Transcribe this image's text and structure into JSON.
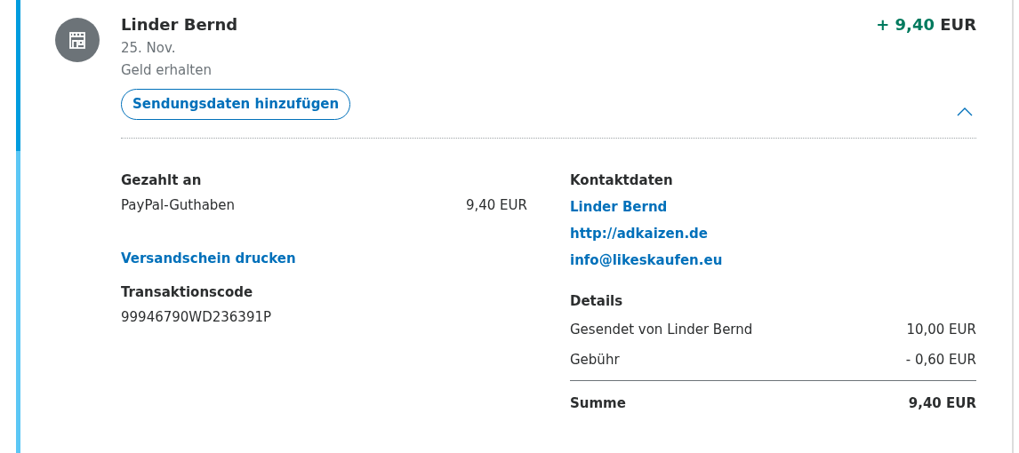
{
  "transaction": {
    "name": "Linder Bernd",
    "date": "25. Nov.",
    "status": "Geld erhalten",
    "amount": "+ 9,40",
    "currency": "EUR",
    "action_button": "Sendungsdaten hinzufügen",
    "expanded": true
  },
  "paid_to": {
    "title": "Gezahlt an",
    "rows": [
      {
        "label": "PayPal-Guthaben",
        "value": "9,40 EUR"
      }
    ]
  },
  "print_link": "Versandschein drucken",
  "transaction_code": {
    "title": "Transaktionscode",
    "value": "99946790WD236391P"
  },
  "contact": {
    "title": "Kontaktdaten",
    "links": [
      "Linder Bernd",
      "http://adkaizen.de",
      "info@likeskaufen.eu"
    ]
  },
  "details": {
    "title": "Details",
    "rows": [
      {
        "label": "Gesendet von Linder Bernd",
        "value": "10,00 EUR"
      },
      {
        "label": "Gebühr",
        "value": "- 0,60 EUR"
      }
    ],
    "total": {
      "label": "Summe",
      "value": "9,40 EUR"
    }
  }
}
